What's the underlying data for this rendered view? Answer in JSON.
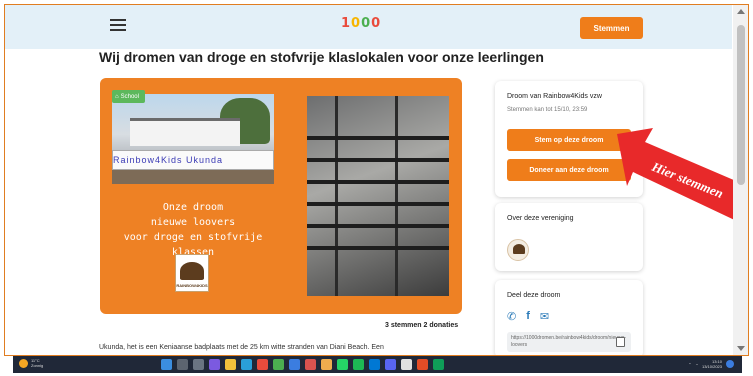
{
  "header": {
    "logo_letters": [
      "1",
      "0",
      "0",
      "0"
    ],
    "vote_button": "Stemmen"
  },
  "page": {
    "title": "Wij dromen van droge en stofvrije klaslokalen voor onze leerlingen"
  },
  "hero": {
    "badge": "School",
    "photo_banner_text": "Rainbow4Kids Ukunda",
    "lines": [
      "Onze droom",
      "nieuwe loovers",
      "voor droge en stofvrije klassen"
    ],
    "logo_label": "RAINBOW4KIDS"
  },
  "stats": "3 stemmen 2 donaties",
  "intro": "Ukunda, het is een Keniaanse badplaats met de 25 km witte stranden van Diani Beach. Een",
  "sidebar": {
    "dream_card": {
      "title": "Droom van Rainbow4Kids vzw",
      "deadline": "Stemmen kan tot 15/10, 23:59",
      "vote_button": "Stem op deze droom",
      "donate_button": "Doneer aan deze droom"
    },
    "org_card": {
      "title": "Over deze vereniging"
    },
    "share_card": {
      "title": "Deel deze droom",
      "link": "https://1000dromen.be/rainbow4kids/droom/nieuwe-loovers"
    }
  },
  "annotation": {
    "text": "Hier stemmen",
    "color": "#e8292a"
  },
  "colors": {
    "accent": "#ef7d1a",
    "header_bg": "#e3f0f8",
    "hero_bg": "#ee8124",
    "badge": "#5cb85c"
  },
  "taskbar": {
    "weather_temp": "11°C",
    "weather_desc": "Zonnig",
    "clock_time": "13:10",
    "clock_date": "13/10/2023"
  }
}
